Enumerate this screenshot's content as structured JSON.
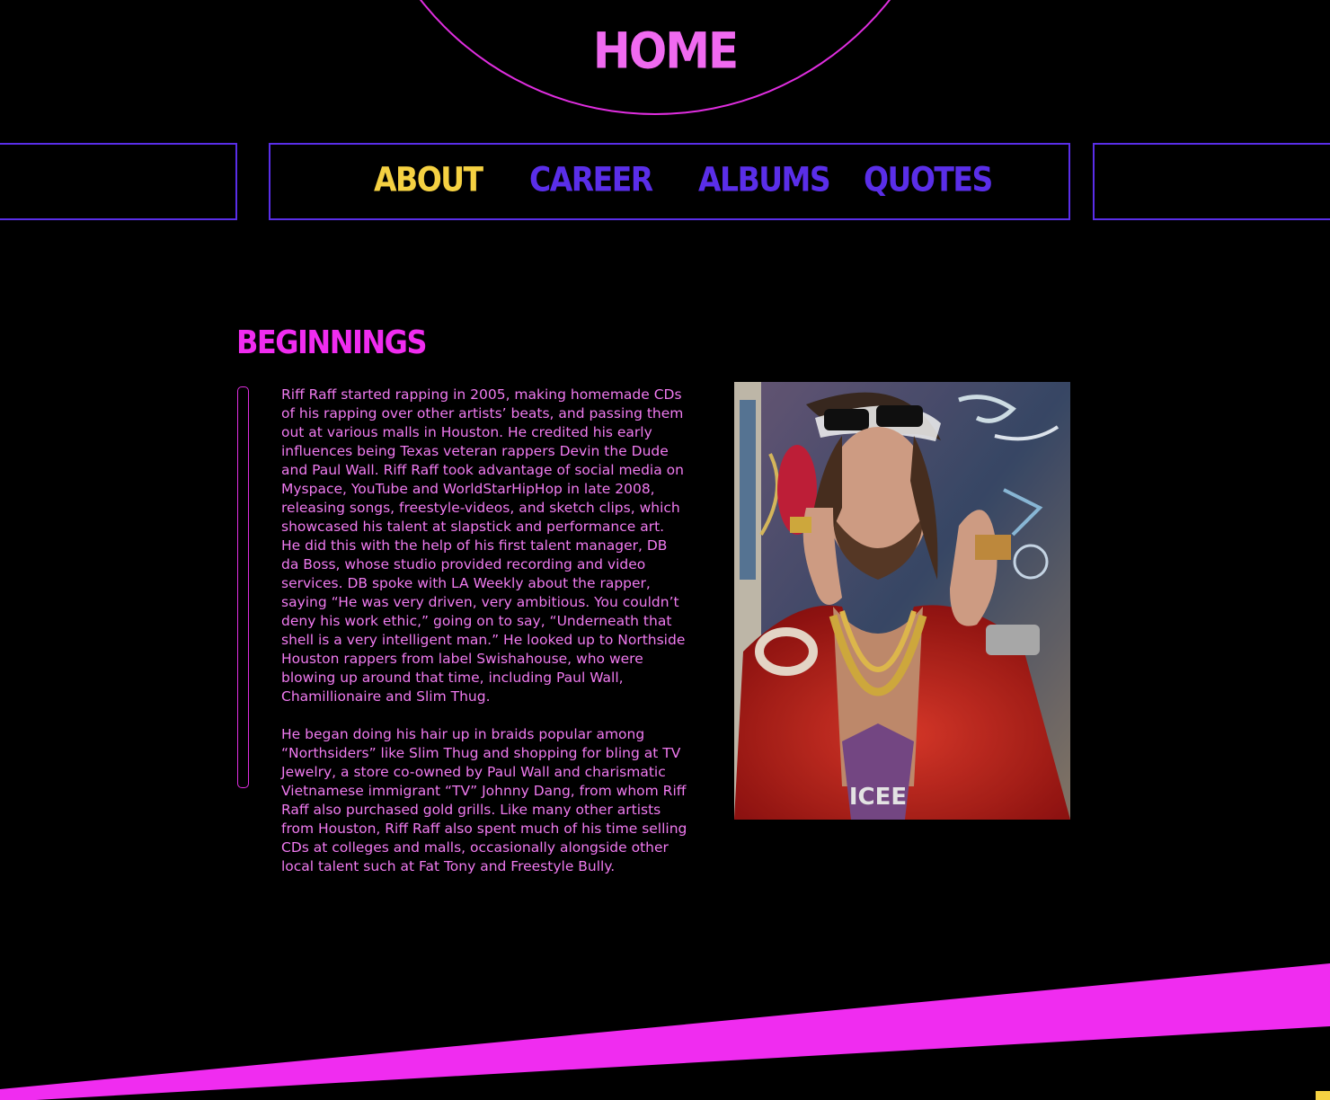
{
  "header": {
    "home_label": "HOME"
  },
  "nav": {
    "items": [
      {
        "label": "ABOUT",
        "active": true
      },
      {
        "label": "CAREER",
        "active": false
      },
      {
        "label": "ALBUMS",
        "active": false
      },
      {
        "label": "QUOTES",
        "active": false
      }
    ]
  },
  "section": {
    "title": "BEGINNINGS",
    "paragraphs": [
      "Riff Raff started rapping in 2005, making homemade CDs of his rapping over other artists’ beats, and passing them out at various malls in Houston. He credited his early influences being Texas veteran rappers Devin the Dude and Paul Wall. Riff Raff took advantage of social media on Myspace, YouTube and WorldStarHipHop in late 2008, releasing songs, freestyle-videos, and sketch clips, which showcased his talent at slapstick and performance art. He did this with the help of his first talent manager, DB da Boss, whose studio provided recording and video services. DB spoke with LA Weekly about the rapper, saying “He was very driven, very ambitious. You couldn’t deny his work ethic,” going on to say, “Underneath that shell is a very intelligent man.” He looked up to Northside Houston rappers from label Swishahouse, who were blowing up around that time, including Paul Wall, Chamillionaire and Slim Thug.",
      "He began doing his hair up in braids popular among “Northsiders” like Slim Thug and shopping for bling at TV Jewelry, a store co-owned by Paul Wall and charismatic Vietnamese immigrant “TV” Johnny Dang, from whom Riff Raff also purchased gold grills. Like many other artists from Houston, Riff Raff also spent much of his time selling CDs at colleges and malls, occasionally alongside other local talent such at Fat Tony and Freestyle Bully."
    ],
    "photo_text": "ICEE"
  },
  "colors": {
    "background": "#000000",
    "accent_magenta": "#f02cf0",
    "nav_purple": "#5a2ee8",
    "active_yellow": "#f5d142",
    "body_text_pink": "#f07af0"
  }
}
